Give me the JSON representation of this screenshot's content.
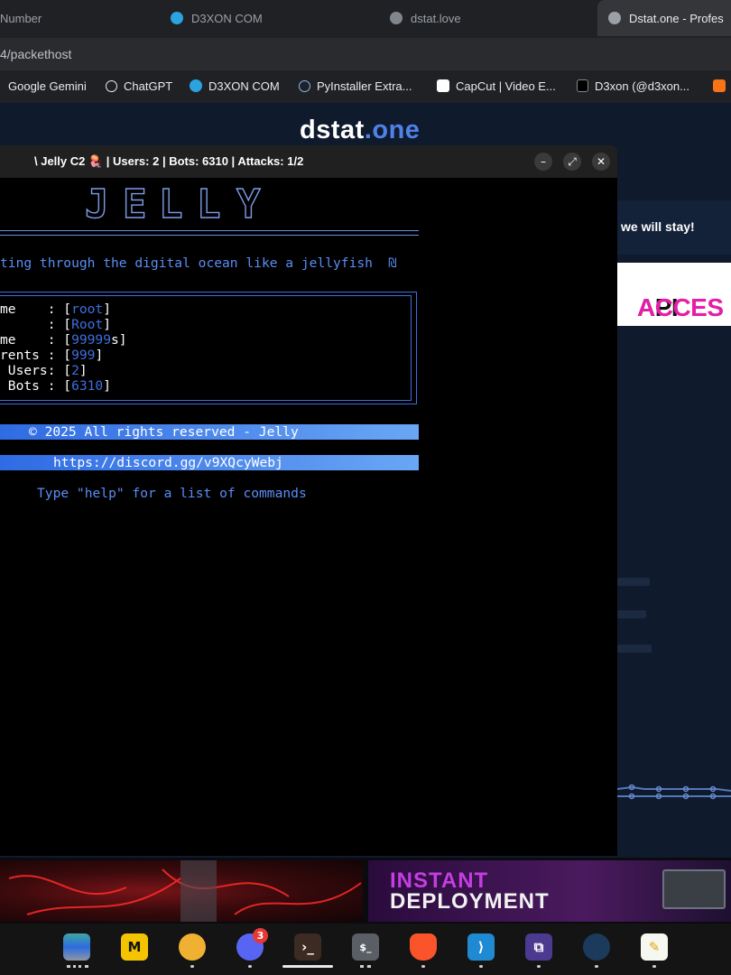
{
  "tabs": [
    {
      "label": "Number",
      "active": false
    },
    {
      "label": "D3XON COM",
      "active": false
    },
    {
      "label": "dstat.love",
      "active": false
    },
    {
      "label": "Dstat.one - Profes",
      "active": true
    }
  ],
  "url": "4/packethost",
  "bookmarks": [
    "Google Gemini",
    "ChatGPT",
    "D3XON COM",
    "PyInstaller Extra...",
    "CapCut | Video E...",
    "D3xon (@d3xon..."
  ],
  "site": {
    "brand_main": "dstat",
    "brand_accent": ".one",
    "banner_text": "we will stay!",
    "ad_api": "API",
    "ad_access": "ACCES"
  },
  "terminal": {
    "title": "\\ Jelly C2 🪼 | Users: 2 | Bots: 6310 | Attacks: 1/2",
    "logo": [
      "J",
      "E",
      "L",
      "L",
      "Y"
    ],
    "tagline": "ting through the digital ocean like a jellyfish  ₪",
    "info": [
      {
        "label": "me    : [",
        "value": "root",
        "end": "]"
      },
      {
        "label": "      : [",
        "value": "Root",
        "end": "]"
      },
      {
        "label": "me    : [",
        "value": "99999",
        "end": "s]"
      },
      {
        "label": "rents : [",
        "value": "999",
        "end": "]"
      },
      {
        "label": " Users: [",
        "value": "2",
        "end": "]"
      },
      {
        "label": " Bots : [",
        "value": "6310",
        "end": "]"
      }
    ],
    "copyright": "© 2025 All rights reserved - Jelly",
    "discord": "https://discord.gg/v9XQcyWebj",
    "help": "Type \"help\" for a list of commands"
  },
  "ads": {
    "deploy_line1": "INSTANT",
    "deploy_line2": "DEPLOYMENT"
  },
  "taskbar": {
    "discord_badge": "3"
  },
  "colors": {
    "accent": "#4f82e8",
    "terminal_blue": "#5b8df5",
    "info_value": "#3d6fe0"
  }
}
